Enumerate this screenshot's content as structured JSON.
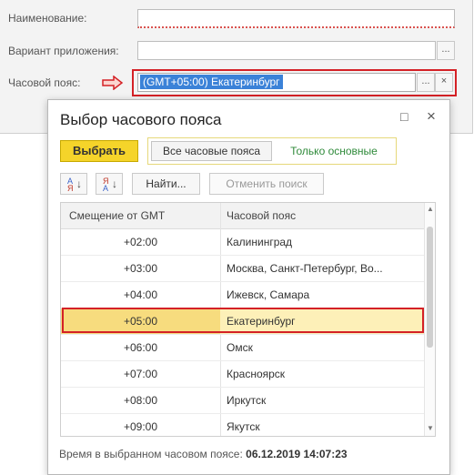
{
  "form": {
    "name_label": "Наименование:",
    "variant_label": "Вариант приложения:",
    "timezone_label": "Часовой пояс:",
    "timezone_value": "(GMT+05:00) Екатеринбург",
    "ellipsis": "...",
    "clear": "×"
  },
  "dialog": {
    "title": "Выбор часового пояса",
    "maximize_icon": "□",
    "close_icon": "×",
    "choose_button": "Выбрать",
    "filter_all": "Все часовые пояса",
    "filter_main": "Только основные",
    "find_button": "Найти...",
    "cancel_search_button": "Отменить поиск",
    "sort_asc_top": "А",
    "sort_asc_bottom": "Я",
    "sort_desc_top": "Я",
    "sort_desc_bottom": "А",
    "columns": [
      "Смещение от GMT",
      "Часовой пояс"
    ],
    "rows": [
      {
        "offset": "+02:00",
        "zone": "Калининград"
      },
      {
        "offset": "+03:00",
        "zone": "Москва, Санкт-Петербург, Во..."
      },
      {
        "offset": "+04:00",
        "zone": "Ижевск, Самара"
      },
      {
        "offset": "+05:00",
        "zone": "Екатеринбург",
        "selected": true
      },
      {
        "offset": "+06:00",
        "zone": "Омск"
      },
      {
        "offset": "+07:00",
        "zone": "Красноярск"
      },
      {
        "offset": "+08:00",
        "zone": "Иркутск"
      },
      {
        "offset": "+09:00",
        "zone": "Якутск"
      }
    ],
    "status_label": "Время в выбранном часовом поясе:",
    "status_value": "06.12.2019 14:07:23"
  },
  "colors": {
    "highlight_red": "#d42126",
    "choose_yellow": "#f5d42a",
    "selection_blue": "#3b82d8",
    "filter_green": "#2f8a3a"
  }
}
